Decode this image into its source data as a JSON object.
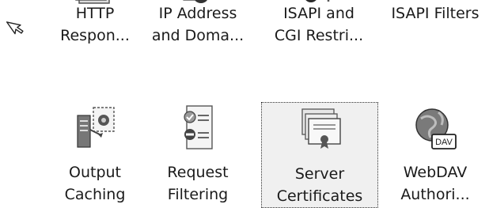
{
  "features": [
    {
      "line1": "HTTP",
      "line2": "Respon...",
      "icon": "http-response-icon"
    },
    {
      "line1": "IP Address",
      "line2": "and Doma...",
      "icon": "ip-address-icon"
    },
    {
      "line1": "ISAPI and",
      "line2": "CGI Restri...",
      "icon": "isapi-cgi-icon"
    },
    {
      "line1": "ISAPI Filters",
      "line2": "",
      "icon": "isapi-filters-icon"
    },
    {
      "line1": "Output",
      "line2": "Caching",
      "icon": "output-caching-icon"
    },
    {
      "line1": "Request",
      "line2": "Filtering",
      "icon": "request-filtering-icon"
    },
    {
      "line1": "Server",
      "line2": "Certificates",
      "icon": "server-certificates-icon",
      "selected": true
    },
    {
      "line1": "WebDAV",
      "line2": "Authori...",
      "icon": "webdav-icon",
      "badge": "DAV"
    }
  ],
  "cursor": {
    "icon": "mouse-pointer-icon"
  },
  "colors": {
    "selection_bg": "#f0f0f0",
    "selection_border": "#333333",
    "text": "#1a1a1a"
  }
}
